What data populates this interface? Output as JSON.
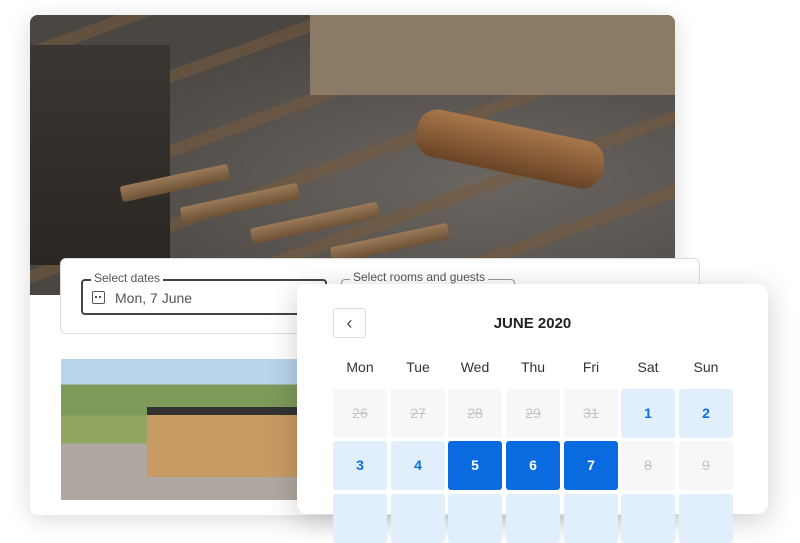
{
  "search": {
    "dates_label": "Select dates",
    "dates_value": "Mon, 7 June",
    "rooms_label": "Select rooms and guests"
  },
  "calendar": {
    "title": "JUNE 2020",
    "prev_icon": "chevron-left-icon",
    "weekdays": [
      "Mon",
      "Tue",
      "Wed",
      "Thu",
      "Fri",
      "Sat",
      "Sun"
    ],
    "rows": [
      [
        {
          "d": "26",
          "s": "dis"
        },
        {
          "d": "27",
          "s": "dis"
        },
        {
          "d": "28",
          "s": "dis"
        },
        {
          "d": "29",
          "s": "dis"
        },
        {
          "d": "31",
          "s": "dis"
        },
        {
          "d": "1",
          "s": "av"
        },
        {
          "d": "2",
          "s": "av"
        }
      ],
      [
        {
          "d": "3",
          "s": "av"
        },
        {
          "d": "4",
          "s": "av"
        },
        {
          "d": "5",
          "s": "sel"
        },
        {
          "d": "6",
          "s": "sel"
        },
        {
          "d": "7",
          "s": "sel"
        },
        {
          "d": "8",
          "s": "dis"
        },
        {
          "d": "9",
          "s": "dis"
        }
      ],
      [
        {
          "d": "",
          "s": "av"
        },
        {
          "d": "",
          "s": "av"
        },
        {
          "d": "",
          "s": "av"
        },
        {
          "d": "",
          "s": "av"
        },
        {
          "d": "",
          "s": "av"
        },
        {
          "d": "",
          "s": "av"
        },
        {
          "d": "",
          "s": "av"
        }
      ]
    ],
    "colors": {
      "selected": "#0a6be0",
      "available": "#e1effd"
    }
  }
}
